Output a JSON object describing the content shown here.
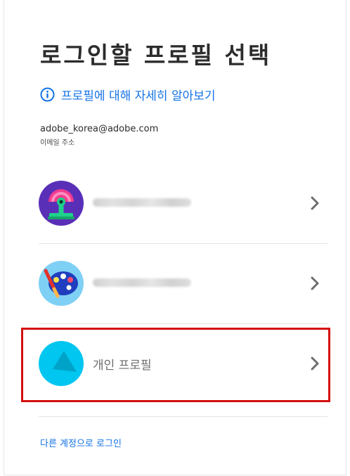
{
  "title": "로그인할 프로필 선택",
  "learn_more": "프로필에 대해 자세히 알아보기",
  "account": {
    "email": "adobe_korea@adobe.com",
    "email_label": "이메일 주소"
  },
  "profiles": [
    {
      "name": "",
      "name_blurred": true,
      "avatar": "pink-stamp-avatar-icon"
    },
    {
      "name": "",
      "name_blurred": true,
      "avatar": "paint-palette-avatar-icon"
    },
    {
      "name": "개인 프로필",
      "name_blurred": false,
      "avatar": "personal-profile-avatar-icon"
    }
  ],
  "other_account": "다른 계정으로 로그인",
  "colors": {
    "link": "#1473e6",
    "highlight": "#d30f0f",
    "personal_avatar": "#00c6f0"
  }
}
